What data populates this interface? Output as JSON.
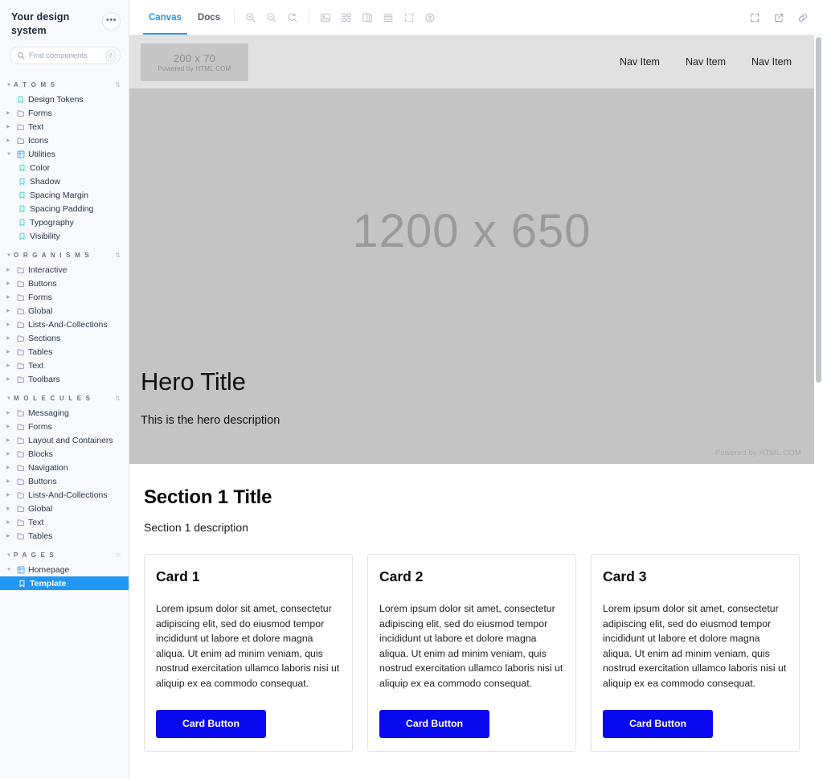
{
  "sidebar": {
    "title": "Your design system",
    "more_label": "•••",
    "search": {
      "placeholder": "Find components",
      "shortcut": "/"
    },
    "groups": [
      {
        "name": "ATOMS",
        "items": [
          {
            "label": "Design Tokens",
            "icon": "bookmark-icon",
            "type": "leaf"
          },
          {
            "label": "Forms",
            "icon": "folder-icon",
            "type": "folder"
          },
          {
            "label": "Text",
            "icon": "folder-icon",
            "type": "folder"
          },
          {
            "label": "Icons",
            "icon": "folder-icon",
            "type": "folder"
          },
          {
            "label": "Utilities",
            "icon": "grid-icon",
            "type": "group-open"
          },
          {
            "label": "Color",
            "icon": "bookmark-icon",
            "type": "child"
          },
          {
            "label": "Shadow",
            "icon": "bookmark-icon",
            "type": "child"
          },
          {
            "label": "Spacing Margin",
            "icon": "bookmark-icon",
            "type": "child"
          },
          {
            "label": "Spacing Padding",
            "icon": "bookmark-icon",
            "type": "child"
          },
          {
            "label": "Typography",
            "icon": "bookmark-icon",
            "type": "child"
          },
          {
            "label": "Visibility",
            "icon": "bookmark-icon",
            "type": "child"
          }
        ]
      },
      {
        "name": "ORGANISMS",
        "items": [
          {
            "label": "Interactive",
            "icon": "folder-icon",
            "type": "folder"
          },
          {
            "label": "Buttons",
            "icon": "folder-icon",
            "type": "folder"
          },
          {
            "label": "Forms",
            "icon": "folder-icon",
            "type": "folder"
          },
          {
            "label": "Global",
            "icon": "folder-icon",
            "type": "folder"
          },
          {
            "label": "Lists-And-Collections",
            "icon": "folder-icon",
            "type": "folder"
          },
          {
            "label": "Sections",
            "icon": "folder-icon",
            "type": "folder"
          },
          {
            "label": "Tables",
            "icon": "folder-icon",
            "type": "folder"
          },
          {
            "label": "Text",
            "icon": "folder-icon",
            "type": "folder"
          },
          {
            "label": "Toolbars",
            "icon": "folder-icon",
            "type": "folder"
          }
        ]
      },
      {
        "name": "MOLECULES",
        "items": [
          {
            "label": "Messaging",
            "icon": "folder-icon",
            "type": "folder"
          },
          {
            "label": "Forms",
            "icon": "folder-icon",
            "type": "folder"
          },
          {
            "label": "Layout and Containers",
            "icon": "folder-icon",
            "type": "folder"
          },
          {
            "label": "Blocks",
            "icon": "folder-icon",
            "type": "folder"
          },
          {
            "label": "Navigation",
            "icon": "folder-icon",
            "type": "folder"
          },
          {
            "label": "Buttons",
            "icon": "folder-icon",
            "type": "folder"
          },
          {
            "label": "Lists-And-Collections",
            "icon": "folder-icon",
            "type": "folder"
          },
          {
            "label": "Global",
            "icon": "folder-icon",
            "type": "folder"
          },
          {
            "label": "Text",
            "icon": "folder-icon",
            "type": "folder"
          },
          {
            "label": "Tables",
            "icon": "folder-icon",
            "type": "folder"
          }
        ]
      },
      {
        "name": "PAGES",
        "items": [
          {
            "label": "Homepage",
            "icon": "grid-icon",
            "type": "group-open"
          },
          {
            "label": "Template",
            "icon": "bookmark-icon",
            "type": "child",
            "selected": true
          }
        ]
      }
    ]
  },
  "toolbar": {
    "tabs": [
      {
        "label": "Canvas",
        "active": true
      },
      {
        "label": "Docs",
        "active": false
      }
    ],
    "tools": [
      "zoom-in-icon",
      "zoom-out-icon",
      "zoom-reset-icon",
      "image-icon",
      "grid-view-icon",
      "layers-icon",
      "ruler-icon",
      "selection-icon",
      "accessibility-icon"
    ],
    "right_tools": [
      "fullscreen-icon",
      "open-external-icon",
      "link-icon"
    ]
  },
  "page": {
    "logo": {
      "dimensions": "200 x 70",
      "credit": "Powered by HTML.COM"
    },
    "nav": [
      "Nav Item",
      "Nav Item",
      "Nav Item"
    ],
    "hero": {
      "placeholder": "1200 x 650",
      "title": "Hero Title",
      "description": "This is the hero description",
      "credit": "Powered by HTML.COM"
    },
    "section": {
      "title": "Section 1 Title",
      "description": "Section 1 description",
      "cards": [
        {
          "title": "Card 1",
          "body": "Lorem ipsum dolor sit amet, consectetur adipiscing elit, sed do eiusmod tempor incididunt ut labore et dolore magna aliqua. Ut enim ad minim veniam, quis nostrud exercitation ullamco laboris nisi ut aliquip ex ea commodo consequat.",
          "button": "Card Button"
        },
        {
          "title": "Card 2",
          "body": "Lorem ipsum dolor sit amet, consectetur adipiscing elit, sed do eiusmod tempor incididunt ut labore et dolore magna aliqua. Ut enim ad minim veniam, quis nostrud exercitation ullamco laboris nisi ut aliquip ex ea commodo consequat.",
          "button": "Card Button"
        },
        {
          "title": "Card 3",
          "body": "Lorem ipsum dolor sit amet, consectetur adipiscing elit, sed do eiusmod tempor incididunt ut labore et dolore magna aliqua. Ut enim ad minim veniam, quis nostrud exercitation ullamco laboris nisi ut aliquip ex ea commodo consequat.",
          "button": "Card Button"
        }
      ]
    }
  },
  "colors": {
    "accent": "#2196f3",
    "button": "#0a0af0",
    "folder_icon": "#9b8bd6",
    "leaf_icon": "#4ad3c8",
    "grid_icon": "#4aa3f0"
  }
}
